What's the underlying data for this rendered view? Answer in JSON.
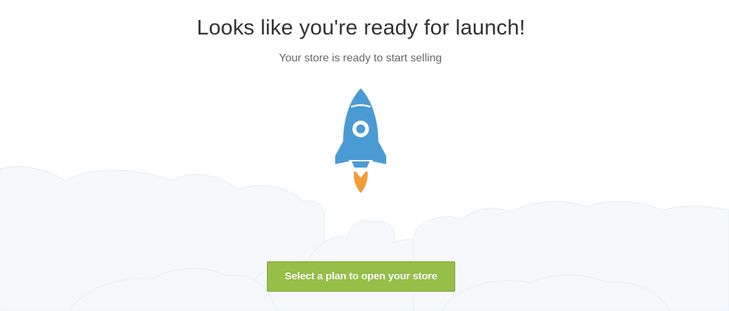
{
  "launch": {
    "title": "Looks like you're ready for launch!",
    "subtitle": "Your store is ready to start selling",
    "cta_label": "Select a plan to open your store",
    "illustration": "rocket-icon"
  },
  "colors": {
    "rocket_body": "#4a9bd4",
    "rocket_flame": "#f49a37",
    "cta_background": "#95bf47",
    "cloud_fill": "#f6f9fb",
    "cloud_stroke": "#ebf1f6",
    "title_text": "#333333",
    "subtitle_text": "#666666"
  }
}
